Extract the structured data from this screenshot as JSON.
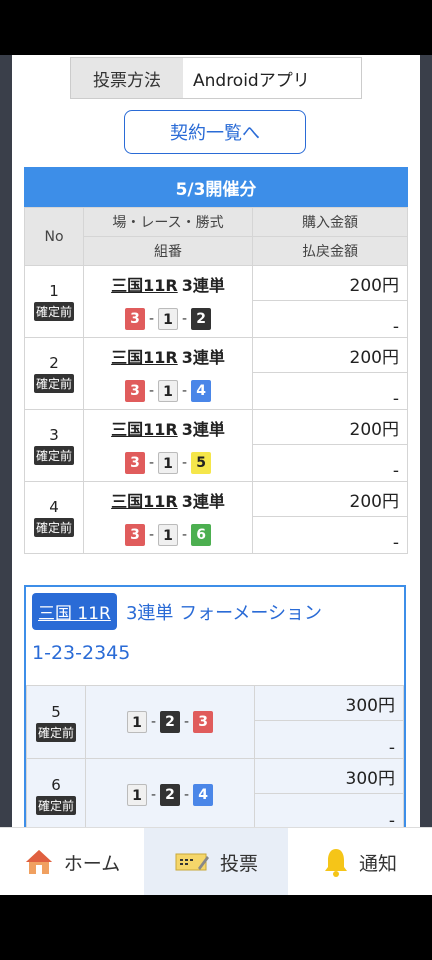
{
  "vote_method": {
    "label": "投票方法",
    "value": "Androidアプリ"
  },
  "contract_button": "契約一覧へ",
  "date_header": "5/3開催分",
  "table_header": {
    "no": "No",
    "race_type": "場・レース・勝式",
    "purchase": "購入金額",
    "combination": "組番",
    "refund": "払戻金額"
  },
  "status_label": "確定前",
  "rows": [
    {
      "no": "1",
      "race": "三国11R",
      "type": "3連単",
      "combo": [
        "3",
        "1",
        "2"
      ],
      "colors": [
        "#e05c5c",
        "#f0f0f0",
        "#333333"
      ],
      "text_colors": [
        "#ffffff",
        "#222222",
        "#ffffff"
      ],
      "amount": "200円",
      "refund": "-"
    },
    {
      "no": "2",
      "race": "三国11R",
      "type": "3連単",
      "combo": [
        "3",
        "1",
        "4"
      ],
      "colors": [
        "#e05c5c",
        "#f0f0f0",
        "#4a86e8"
      ],
      "text_colors": [
        "#ffffff",
        "#222222",
        "#ffffff"
      ],
      "amount": "200円",
      "refund": "-"
    },
    {
      "no": "3",
      "race": "三国11R",
      "type": "3連単",
      "combo": [
        "3",
        "1",
        "5"
      ],
      "colors": [
        "#e05c5c",
        "#f0f0f0",
        "#f5e64a"
      ],
      "text_colors": [
        "#ffffff",
        "#222222",
        "#222222"
      ],
      "amount": "200円",
      "refund": "-"
    },
    {
      "no": "4",
      "race": "三国11R",
      "type": "3連単",
      "combo": [
        "3",
        "1",
        "6"
      ],
      "colors": [
        "#e05c5c",
        "#f0f0f0",
        "#4caf50"
      ],
      "text_colors": [
        "#ffffff",
        "#222222",
        "#ffffff"
      ],
      "amount": "200円",
      "refund": "-"
    }
  ],
  "formation": {
    "race": "三国 11R",
    "title": "3連単 フォーメーション",
    "combo": "1-23-2345",
    "rows": [
      {
        "no": "5",
        "combo": [
          "1",
          "2",
          "3"
        ],
        "colors": [
          "#f0f0f0",
          "#333333",
          "#e05c5c"
        ],
        "text_colors": [
          "#222222",
          "#ffffff",
          "#ffffff"
        ],
        "amount": "300円",
        "refund": "-"
      },
      {
        "no": "6",
        "combo": [
          "1",
          "2",
          "4"
        ],
        "colors": [
          "#f0f0f0",
          "#333333",
          "#4a86e8"
        ],
        "text_colors": [
          "#222222",
          "#ffffff",
          "#ffffff"
        ],
        "amount": "300円",
        "refund": "-"
      }
    ]
  },
  "nav": [
    {
      "label": "ホーム",
      "icon": "home-icon"
    },
    {
      "label": "投票",
      "icon": "ticket-icon",
      "active": true
    },
    {
      "label": "通知",
      "icon": "bell-icon"
    }
  ]
}
